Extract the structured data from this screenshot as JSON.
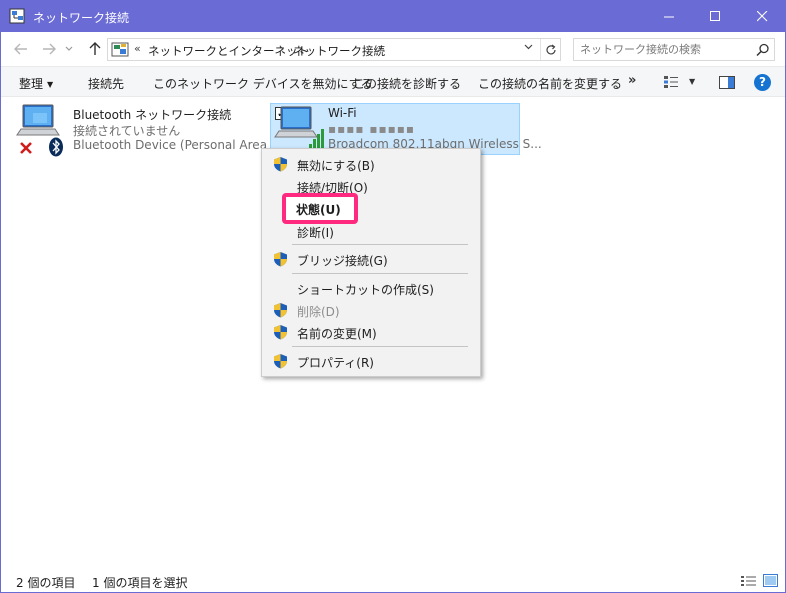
{
  "window": {
    "title": "ネットワーク接続",
    "accent": "#6b6bd6"
  },
  "address": {
    "prefix": "«",
    "crumbs": [
      "ネットワークとインターネット",
      "ネットワーク接続"
    ],
    "search_placeholder": "ネットワーク接続の検索"
  },
  "toolbar": {
    "organize": "整理",
    "connect_to": "接続先",
    "disable_device": "このネットワーク デバイスを無効にする",
    "diagnose": "この接続を診断する",
    "rename": "この接続の名前を変更する",
    "more": "»"
  },
  "connections": [
    {
      "name": "Bluetooth ネットワーク接続",
      "status": "接続されていません",
      "device": "Bluetooth Device (Personal Area ..."
    },
    {
      "name": "Wi-Fi",
      "status": "▪▪▪▪ ▪▪▪▪▪",
      "device": "Broadcom 802.11abgn Wireless S..."
    }
  ],
  "context_menu": {
    "items": [
      {
        "label": "無効にする(B)",
        "shield": true
      },
      {
        "label": "接続/切断(O)",
        "shield": false
      },
      {
        "label": "状態(U)",
        "shield": false,
        "bold": true
      },
      {
        "label": "診断(I)",
        "shield": false
      },
      {
        "label": "ブリッジ接続(G)",
        "shield": true
      },
      {
        "label": "ショートカットの作成(S)",
        "shield": false
      },
      {
        "label": "削除(D)",
        "shield": true,
        "disabled": true
      },
      {
        "label": "名前の変更(M)",
        "shield": true
      },
      {
        "label": "プロパティ(R)",
        "shield": true
      }
    ],
    "highlight_color": "#ff2a7f"
  },
  "status": {
    "count": "2 個の項目",
    "selected": "1 個の項目を選択"
  }
}
